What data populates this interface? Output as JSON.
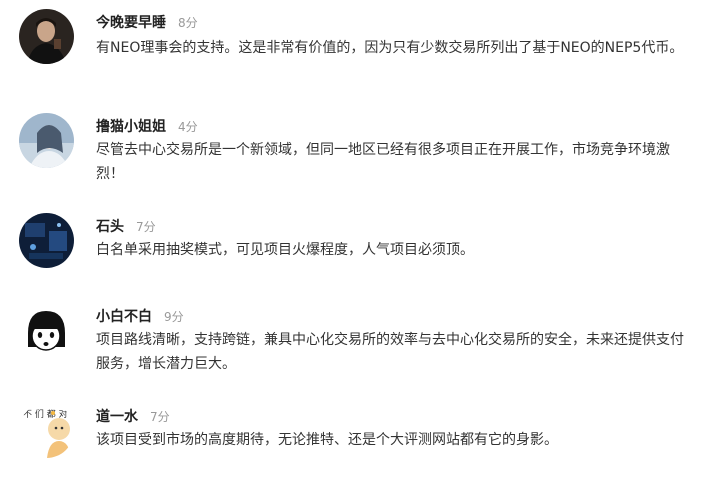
{
  "comments": [
    {
      "username": "今晚要早睡",
      "time": "8分",
      "text": "有NEO理事会的支持。这是非常有价值的，因为只有少数交易所列出了基于NEO的NEP5代币。"
    },
    {
      "username": "撸猫小姐姐",
      "time": "4分",
      "text": "尽管去中心交易所是一个新领域，但同一地区已经有很多项目正在开展工作，市场竞争环境激烈！"
    },
    {
      "username": "石头",
      "time": "7分",
      "text": "白名单采用抽奖模式，可见项目火爆程度，人气项目必须顶。"
    },
    {
      "username": "小白不白",
      "time": "9分",
      "text": "项目路线清晰，支持跨链，兼具中心化交易所的效率与去中心化交易所的安全，未来还提供支付服务，增长潜力巨大。"
    },
    {
      "username": "道一水",
      "time": "7分",
      "text": "该项目受到市场的高度期待，无论推特、还是个大评测网站都有它的身影。",
      "avatar_text": "不 们 都 对"
    }
  ]
}
